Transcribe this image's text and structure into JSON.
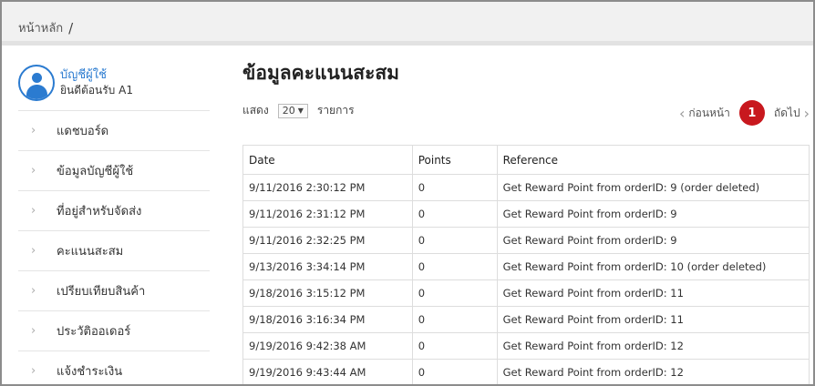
{
  "breadcrumb": {
    "home": "หน้าหลัก",
    "separator": "/"
  },
  "account": {
    "title": "บัญชีผู้ใช้",
    "welcome": "ยินดีต้อนรับ A1"
  },
  "sidebar": {
    "items": [
      {
        "label": "แดชบอร์ด",
        "icon": "chevron-right-icon"
      },
      {
        "label": "ข้อมูลบัญชีผู้ใช้",
        "icon": "chevron-right-icon"
      },
      {
        "label": "ที่อยู่สำหรับจัดส่ง",
        "icon": "chevron-right-icon"
      },
      {
        "label": "คะแนนสะสม",
        "icon": "chevron-right-icon"
      },
      {
        "label": "เปรียบเทียบสินค้า",
        "icon": "chevron-right-icon"
      },
      {
        "label": "ประวัติออเดอร์",
        "icon": "chevron-right-icon"
      },
      {
        "label": "แจ้งชำระเงิน",
        "icon": "chevron-right-icon"
      }
    ]
  },
  "main": {
    "title": "ข้อมูลคะแนนสะสม",
    "show_label": "แสดง",
    "page_size": "20",
    "items_label": "รายการ",
    "pager": {
      "prev": "ก่อนหน้า",
      "current_page": "1",
      "next": "ถัดไป",
      "accent": "#c8181e"
    }
  },
  "table": {
    "columns": [
      "Date",
      "Points",
      "Reference"
    ],
    "rows": [
      [
        "9/11/2016 2:30:12 PM",
        "0",
        "Get Reward Point from orderID: 9 (order deleted)"
      ],
      [
        "9/11/2016 2:31:12 PM",
        "0",
        "Get Reward Point from orderID: 9"
      ],
      [
        "9/11/2016 2:32:25 PM",
        "0",
        "Get Reward Point from orderID: 9"
      ],
      [
        "9/13/2016 3:34:14 PM",
        "0",
        "Get Reward Point from orderID: 10 (order deleted)"
      ],
      [
        "9/18/2016 3:15:12 PM",
        "0",
        "Get Reward Point from orderID: 11"
      ],
      [
        "9/18/2016 3:16:34 PM",
        "0",
        "Get Reward Point from orderID: 11"
      ],
      [
        "9/19/2016 9:42:38 AM",
        "0",
        "Get Reward Point from orderID: 12"
      ],
      [
        "9/19/2016 9:43:44 AM",
        "0",
        "Get Reward Point from orderID: 12"
      ]
    ]
  },
  "colors": {
    "brand_blue": "#2b7bd0",
    "accent_red": "#c8181e"
  }
}
